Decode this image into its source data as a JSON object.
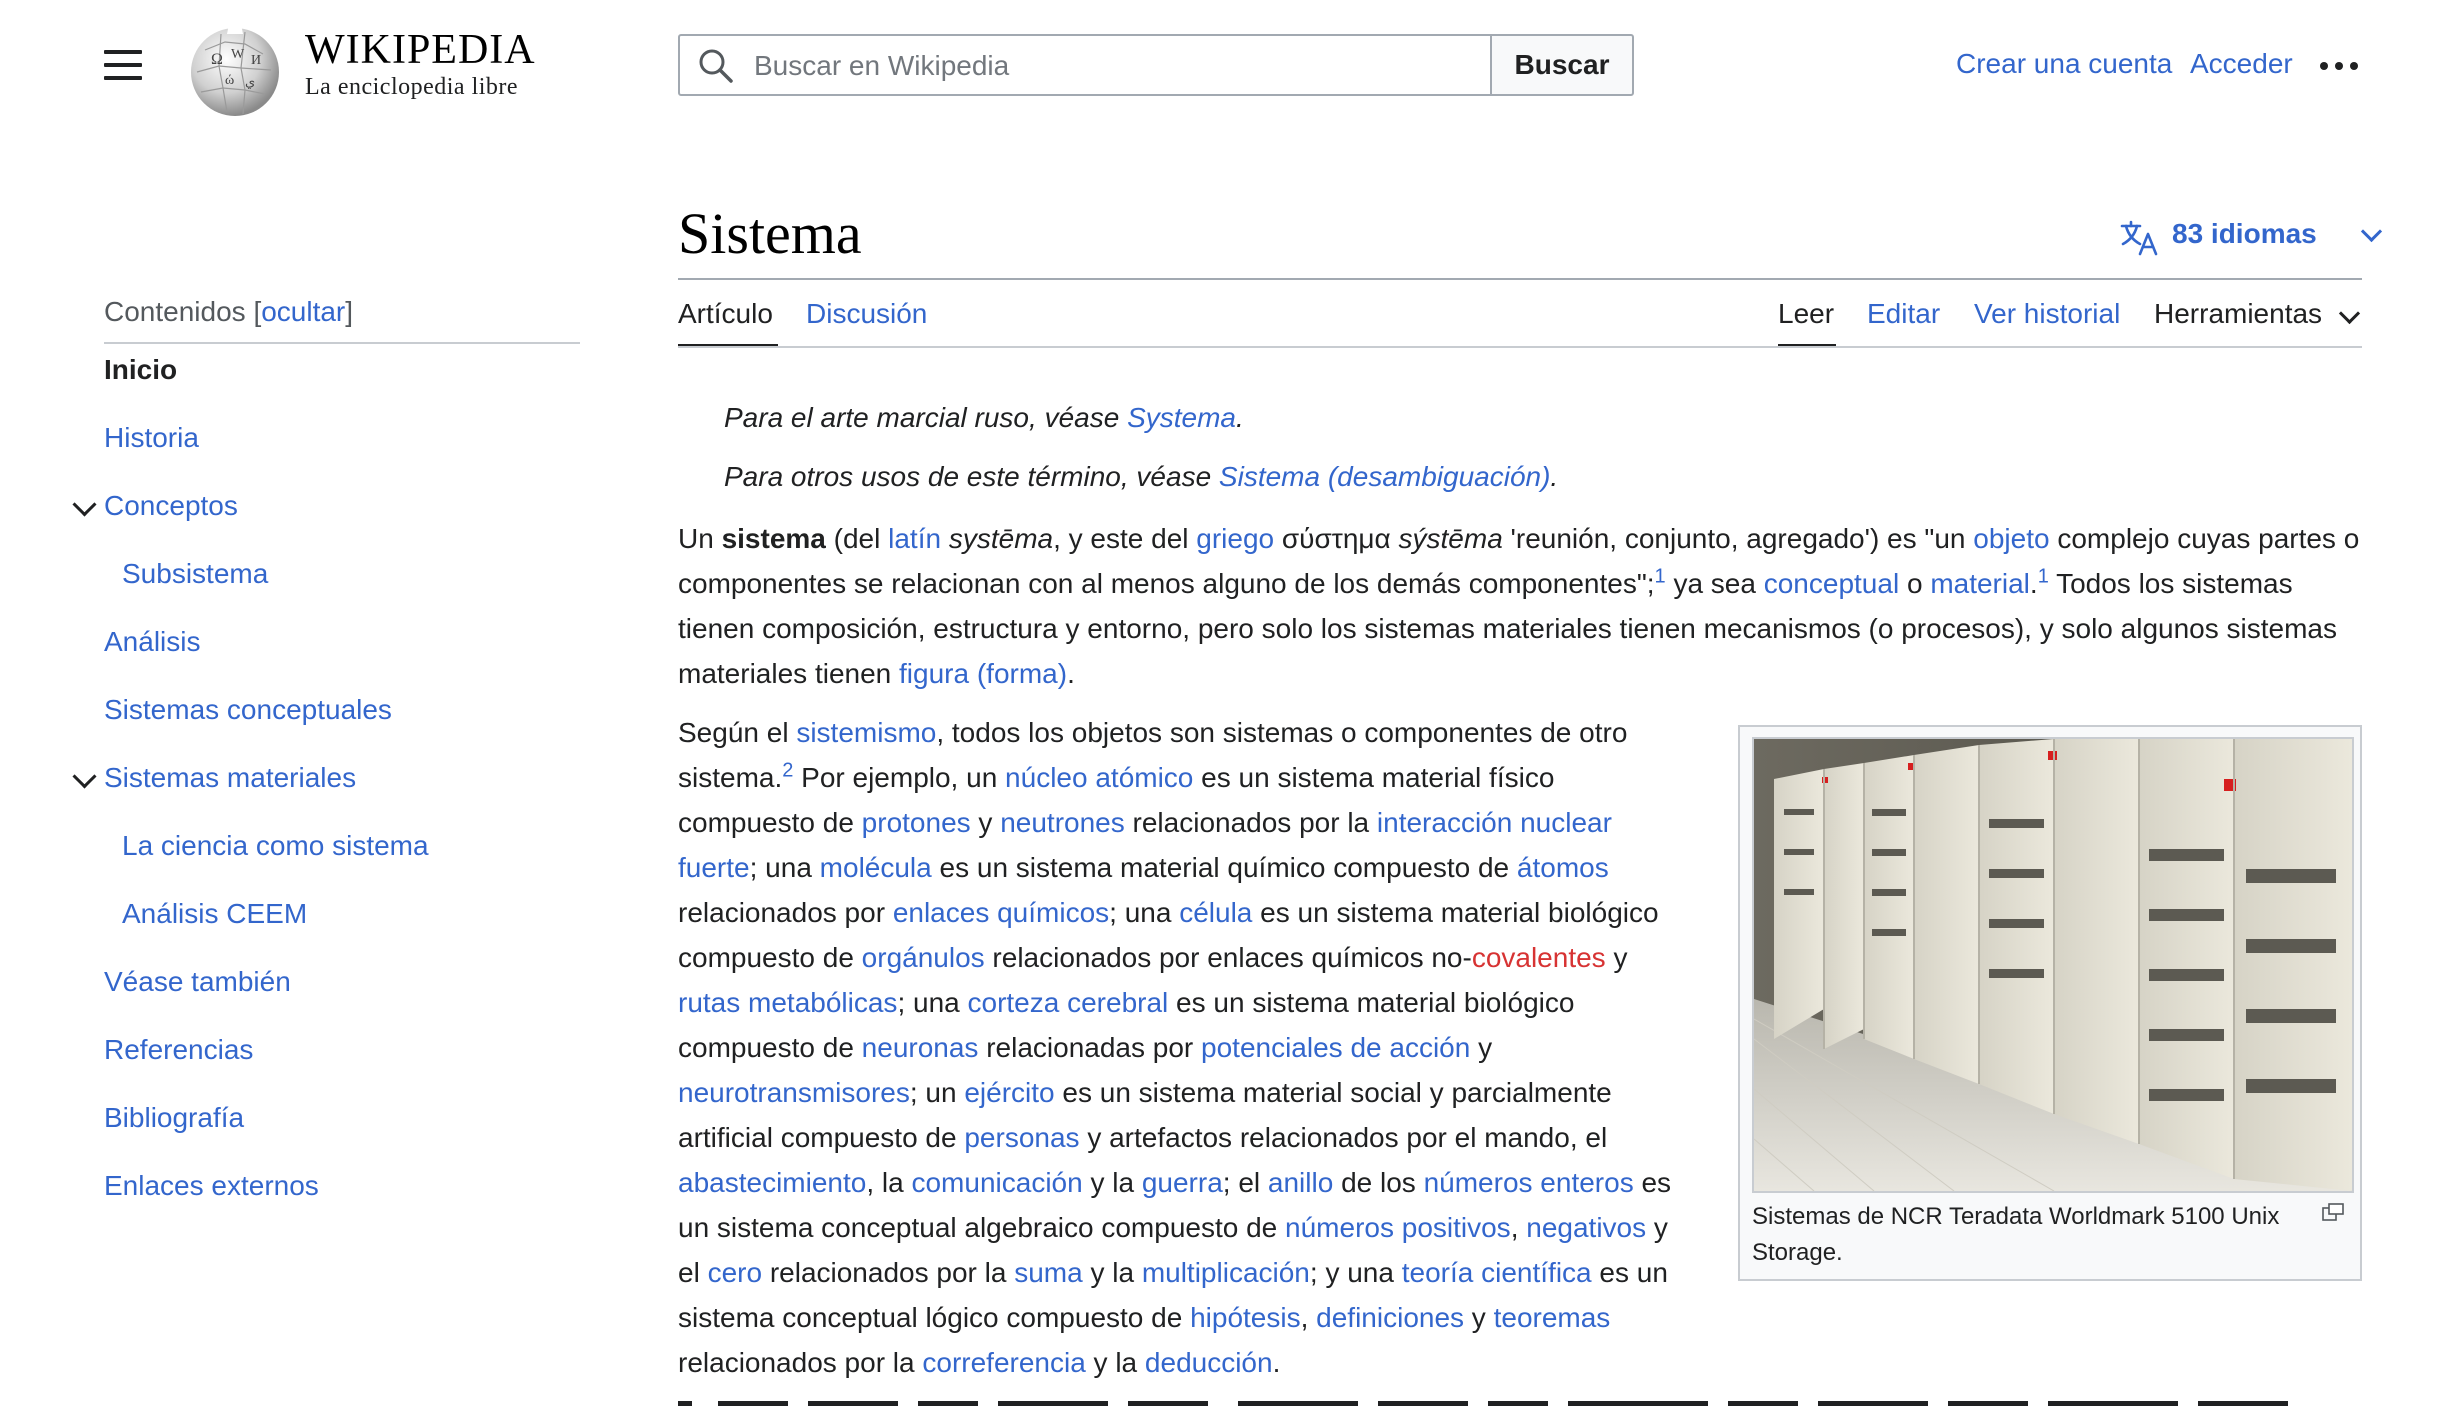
{
  "header": {
    "menu_icon": "hamburger-menu-icon",
    "logo_icon": "wikipedia-globe-logo",
    "wordmark": "WIKIPEDIA",
    "tagline": "La enciclopedia libre",
    "search": {
      "placeholder": "Buscar en Wikipedia",
      "button_label": "Buscar",
      "icon": "search-icon"
    },
    "create_account": "Crear una cuenta",
    "login": "Acceder",
    "more_icon": "ellipsis-icon"
  },
  "toc": {
    "label": "Contenidos",
    "toggle": "ocultar",
    "items": [
      {
        "label": "Inicio",
        "active": true,
        "level": 1,
        "expandable": false
      },
      {
        "label": "Historia",
        "level": 1,
        "expandable": false
      },
      {
        "label": "Conceptos",
        "level": 1,
        "expandable": true
      },
      {
        "label": "Subsistema",
        "level": 2,
        "expandable": false
      },
      {
        "label": "Análisis",
        "level": 1,
        "expandable": false
      },
      {
        "label": "Sistemas conceptuales",
        "level": 1,
        "expandable": false
      },
      {
        "label": "Sistemas materiales",
        "level": 1,
        "expandable": true
      },
      {
        "label": "La ciencia como sistema",
        "level": 2,
        "expandable": false
      },
      {
        "label": "Análisis CEEM",
        "level": 2,
        "expandable": false
      },
      {
        "label": "Véase también",
        "level": 1,
        "expandable": false
      },
      {
        "label": "Referencias",
        "level": 1,
        "expandable": false
      },
      {
        "label": "Bibliografía",
        "level": 1,
        "expandable": false
      },
      {
        "label": "Enlaces externos",
        "level": 1,
        "expandable": false
      }
    ]
  },
  "article": {
    "title": "Sistema",
    "languages": "83 idiomas",
    "tabs_left": [
      "Artículo",
      "Discusión"
    ],
    "tabs_right": [
      "Leer",
      "Editar",
      "Ver historial",
      "Herramientas"
    ],
    "hatnotes": [
      {
        "prefix": "Para el arte marcial ruso, véase ",
        "link": "Systema",
        "suffix": "."
      },
      {
        "prefix": "Para otros usos de este término, véase ",
        "link": "Sistema (desambiguación)",
        "suffix": "."
      }
    ],
    "intro": {
      "t1": "Un ",
      "b1": "sistema",
      "t2": " (del ",
      "l_latin": "latín",
      "t3": " ",
      "i_systema": "systēma",
      "t4": ", y este del ",
      "l_griego": "griego",
      "t5": " σύστημα ",
      "i_systema2": "sýstēma",
      "t6": " 'reunión, conjunto, agregado') es \"un ",
      "l_objeto": "objeto",
      "t7": " complejo cuyas partes o componentes se relacionan con al menos alguno de los demás componentes\";",
      "ref1": "1",
      "t8": " ya sea ",
      "l_conceptual": "conceptual",
      "t9": " o ",
      "l_material": "material",
      "t10": ".",
      "ref1b": "1",
      "t11": " Todos los sistemas tienen composición, estructura y entorno, pero solo los sistemas materiales tienen mecanismos (o procesos), y solo algunos sistemas materiales tienen ",
      "l_figura": "figura (forma)",
      "t12": "."
    },
    "para2": {
      "t1": "Según el ",
      "l_sistemismo": "sistemismo",
      "t2": ", todos los objetos son sistemas o componentes de otro sistema.",
      "ref2": "2",
      "t3": " Por ejemplo, un ",
      "l_nucleo": "núcleo atómico",
      "t4": " es un sistema material físico compuesto de ",
      "l_protones": "protones",
      "t5": " y ",
      "l_neutrones": "neutrones",
      "t6": " relacionados por la ",
      "l_interaccion": "interacción nuclear fuerte",
      "t7": "; una ",
      "l_molecula": "molécula",
      "t8": " es un sistema material químico compuesto de ",
      "l_atomos": "átomos",
      "t9": " relacionados por ",
      "l_enlaces": "enlaces químicos",
      "t10": "; una ",
      "l_celula": "célula",
      "t11": " es un sistema material biológico compuesto de ",
      "l_organulos": "orgánulos",
      "t12": " relacionados por enlaces químicos no-",
      "l_covalentes": "covalentes",
      "t13": " y ",
      "l_rutas": "rutas metabólicas",
      "t14": "; una ",
      "l_corteza": "corteza cerebral",
      "t15": " es un sistema material biológico compuesto de ",
      "l_neuronas": "neuronas",
      "t16": " relacionadas por ",
      "l_potenciales": "potenciales de acción",
      "t17": " y ",
      "l_neurotrans": "neurotransmisores",
      "t18": "; un ",
      "l_ejercito": "ejército",
      "t19": " es un sistema material social y parcialmente artificial compuesto de ",
      "l_personas": "personas",
      "t20": " y artefactos relacionados por el mando, el ",
      "l_abast": "abastecimiento",
      "t21": ", la ",
      "l_comunicacion": "comunicación",
      "t22": " y la ",
      "l_guerra": "guerra",
      "t23": "; el ",
      "l_anillo": "anillo",
      "t24": " de los ",
      "l_enteros": "números enteros",
      "t25": " es un sistema conceptual algebraico compuesto de ",
      "l_positivos": "números positivos",
      "t26": ", ",
      "l_negativos": "negativos",
      "t27": " y el ",
      "l_cero": "cero",
      "t28": " relacionados por la ",
      "l_suma": "suma",
      "t29": " y la ",
      "l_multiplicacion": "multiplicación",
      "t30": "; y una ",
      "l_teoria": "teoría científica",
      "t31": " es un sistema conceptual lógico compuesto de ",
      "l_hipotesis": "hipótesis",
      "t32": ", ",
      "l_definiciones": "definiciones",
      "t33": " y ",
      "l_teoremas": "teoremas",
      "t34": " relacionados por la ",
      "l_correferencia": "correferencia",
      "t35": " y la ",
      "l_deduccion": "deducción",
      "t36": "."
    },
    "figure": {
      "caption": "Sistemas de NCR Teradata Worldmark 5100 Unix Storage.",
      "magnify_icon": "enlarge-icon"
    }
  },
  "colors": {
    "link": "#3366cc",
    "redlink": "#d73333",
    "text": "#202122",
    "border": "#a2a9b1"
  }
}
